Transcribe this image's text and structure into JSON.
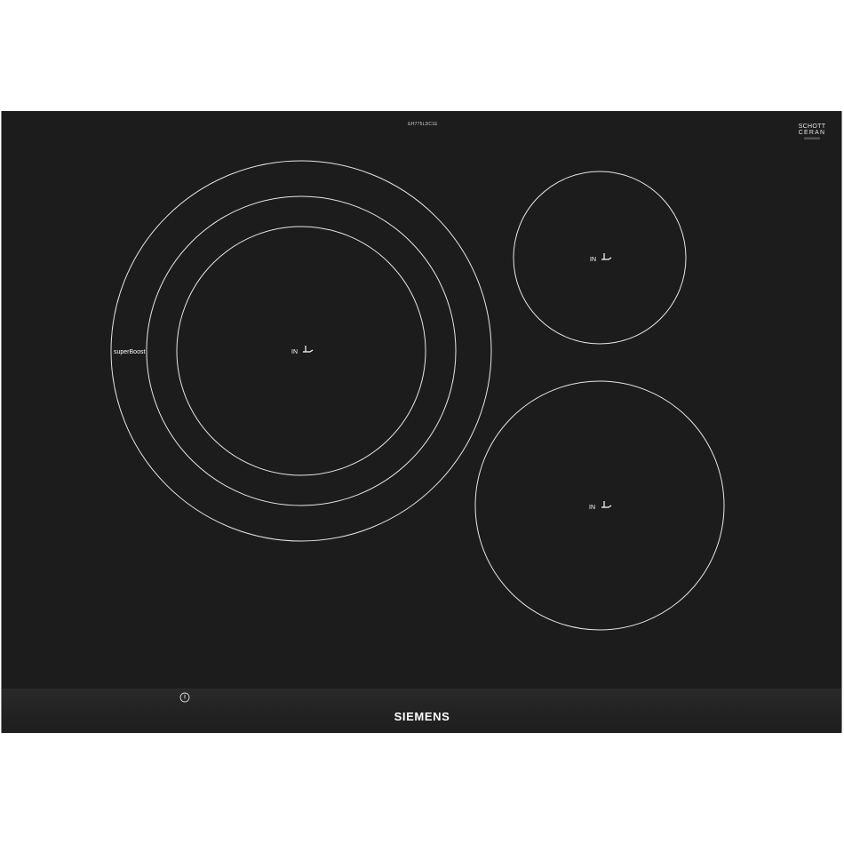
{
  "product": {
    "model_code": "EH775LDC1E",
    "glass_brand_line1": "SCHOTT",
    "glass_brand_line2": "CERAN",
    "glass_code": "000000000",
    "brand": "SIEMENS",
    "superboost_label": "superBoost"
  },
  "zones": [
    {
      "label": "IN",
      "icon": "cookware-on-zone-icon"
    },
    {
      "label": "IN",
      "icon": "cookware-on-zone-icon"
    },
    {
      "label": "IN",
      "icon": "cookware-on-zone-icon"
    }
  ],
  "controls": {
    "power_icon": "power-icon"
  },
  "colors": {
    "glass": "#1c1c1c",
    "zone_lines": "#e6e6e6",
    "control_strip": "#262626",
    "frame": "#8a8a8a"
  }
}
